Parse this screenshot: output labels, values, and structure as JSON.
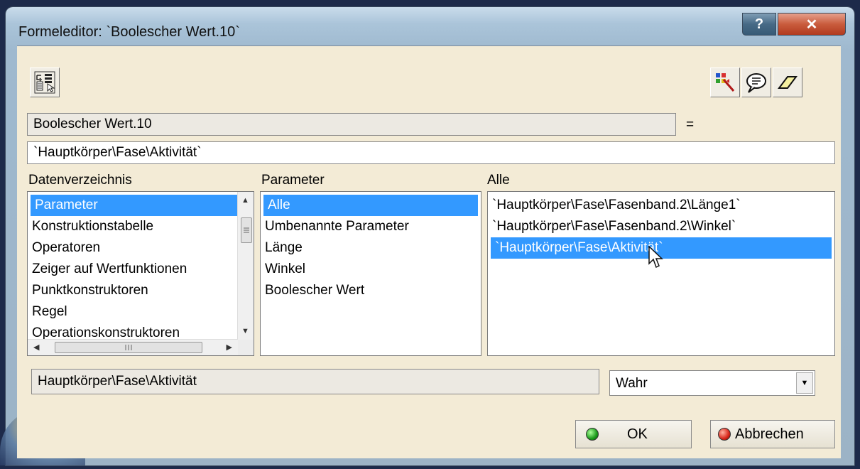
{
  "window": {
    "title": "Formeleditor: `Boolescher Wert.10`",
    "help_label": "?",
    "close_label": "✕"
  },
  "toolbar": {
    "tree_icon": "formula-tree-icon",
    "right_icons": [
      "select-icon",
      "comment-icon",
      "eraser-icon"
    ]
  },
  "parameter_name": "Boolescher Wert.10",
  "equals_sign": "=",
  "formula": "`Hauptkörper\\Fase\\Aktivität`",
  "lists": {
    "datenverzeichnis": {
      "header": "Datenverzeichnis",
      "items": [
        "Parameter",
        "Konstruktionstabelle",
        "Operatoren",
        "Zeiger auf Wertfunktionen",
        "Punktkonstruktoren",
        "Regel",
        "Operationskonstruktoren"
      ],
      "selected_index": 0
    },
    "parameter": {
      "header": "Parameter",
      "items": [
        "Alle",
        "Umbenannte Parameter",
        "Länge",
        "Winkel",
        "Boolescher Wert"
      ],
      "selected_index": 0
    },
    "alle": {
      "header": "Alle",
      "items": [
        "`Hauptkörper\\Fase\\Fasenband.2\\Länge1`",
        "`Hauptkörper\\Fase\\Fasenband.2\\Winkel`",
        "`Hauptkörper\\Fase\\Aktivität`"
      ],
      "selected_index": 2
    }
  },
  "selected_path": "Hauptkörper\\Fase\\Aktivität",
  "value_select": "Wahr",
  "buttons": {
    "ok": "OK",
    "cancel": "Abbrechen"
  },
  "colors": {
    "selection": "#3399ff",
    "dialog_bg": "#f3ebd6",
    "ok_led": "#1a9a1a",
    "cancel_led": "#d8261a"
  }
}
